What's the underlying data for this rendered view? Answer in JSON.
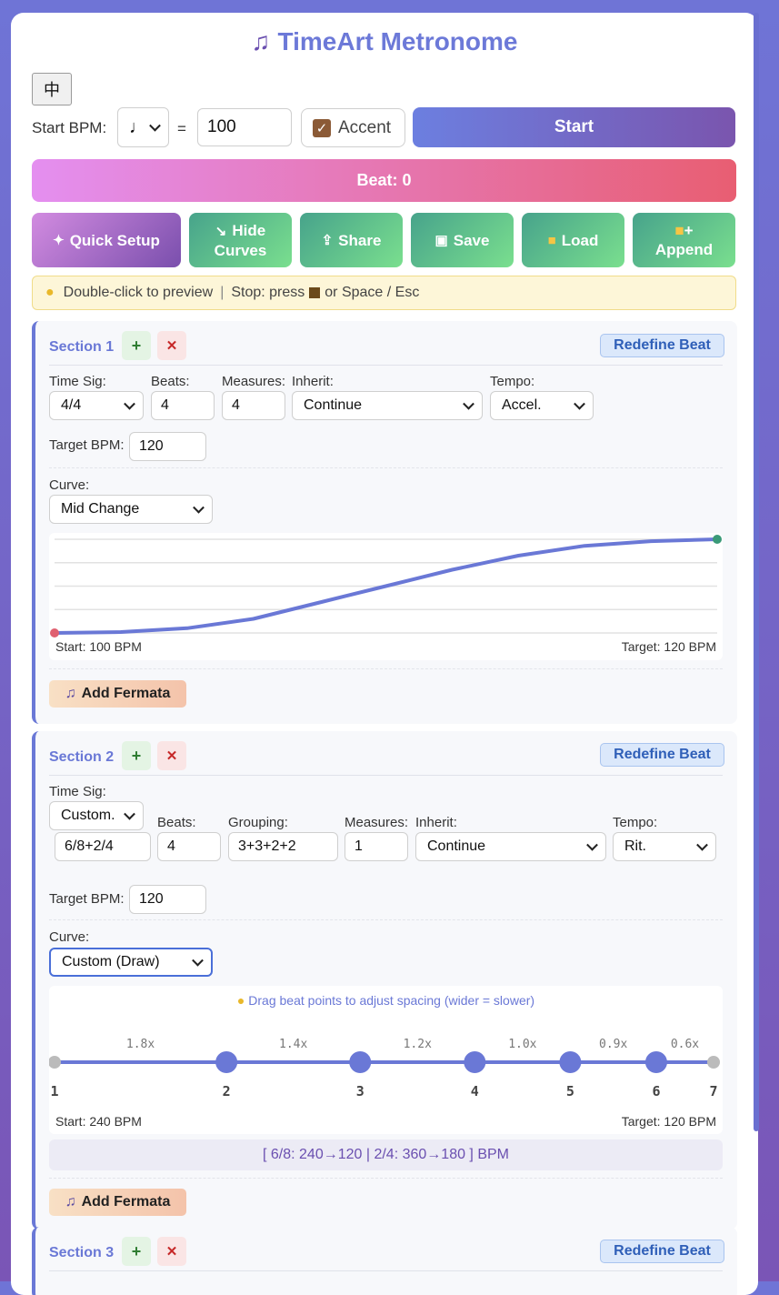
{
  "app": {
    "title": "TimeArt Metronome",
    "title_icon": "music-note-icon",
    "lang_button": "中"
  },
  "controls": {
    "start_bpm_label": "Start BPM:",
    "note_value": "♩",
    "equals": "=",
    "bpm_value": "100",
    "accent_label": "Accent",
    "accent_checked": true,
    "start_label": "Start"
  },
  "beat_display": "Beat: 0",
  "toolbar": {
    "quick_setup": "Quick Setup",
    "hide_curves_1": "Hide",
    "hide_curves_2": "Curves",
    "share": "Share",
    "save": "Save",
    "load": "Load",
    "append_1": "+",
    "append_2": "Append"
  },
  "hint": {
    "part1": "Double-click to preview",
    "sep": "|",
    "part2": "Stop: press",
    "part3": "or Space / Esc"
  },
  "sections": [
    {
      "title": "Section 1",
      "add": "+",
      "remove": "✕",
      "redefine": "Redefine Beat",
      "time_sig_label": "Time Sig:",
      "time_sig": "4/4",
      "beats_label": "Beats:",
      "beats": "4",
      "measures_label": "Measures:",
      "measures": "4",
      "inherit_label": "Inherit:",
      "inherit": "Continue",
      "tempo_label": "Tempo:",
      "tempo": "Accel.",
      "target_label": "Target BPM:",
      "target": "120",
      "curve_label": "Curve:",
      "curve": "Mid Change",
      "chart_start": "Start: 100 BPM",
      "chart_target": "Target: 120 BPM",
      "fermata": "Add Fermata"
    },
    {
      "title": "Section 2",
      "add": "+",
      "remove": "✕",
      "redefine": "Redefine Beat",
      "time_sig_label": "Time Sig:",
      "time_sig": "Custom.",
      "custom_sig": "6/8+2/4",
      "beats_label": "Beats:",
      "beats": "4",
      "grouping_label": "Grouping:",
      "grouping": "3+3+2+2",
      "measures_label": "Measures:",
      "measures": "1",
      "inherit_label": "Inherit:",
      "inherit": "Continue",
      "tempo_label": "Tempo:",
      "tempo": "Rit.",
      "target_label": "Target BPM:",
      "target": "120",
      "curve_label": "Curve:",
      "curve": "Custom (Draw)",
      "drag_hint": "Drag beat points to adjust spacing (wider = slower)",
      "chart_start": "Start: 240 BPM",
      "chart_target": "Target: 120 BPM",
      "bpm_summary": "[ 6/8: 240→120 | 2/4: 360→180 ] BPM",
      "fermata": "Add Fermata"
    },
    {
      "title": "Section 3",
      "add": "+",
      "remove": "✕",
      "redefine": "Redefine Beat"
    }
  ],
  "chart_data": [
    {
      "type": "line",
      "title": "",
      "xlabel": "",
      "ylabel": "",
      "x": [
        0,
        0.1,
        0.2,
        0.3,
        0.4,
        0.5,
        0.6,
        0.7,
        0.8,
        0.9,
        1.0
      ],
      "series": [
        {
          "values": [
            100,
            100.2,
            101,
            103,
            106.5,
            110,
            113.5,
            116.5,
            118.6,
            119.6,
            120
          ]
        }
      ],
      "ylim": [
        100,
        120
      ],
      "grid": true,
      "start_label": "Start: 100 BPM",
      "target_label": "Target: 120 BPM"
    },
    {
      "type": "scatter",
      "title": "",
      "beats": [
        "1",
        "2",
        "3",
        "4",
        "5",
        "6",
        "7"
      ],
      "multipliers": [
        "1.8x",
        "1.4x",
        "1.2x",
        "1.0x",
        "0.9x",
        "0.6x"
      ],
      "multiplier_values": [
        1.8,
        1.4,
        1.2,
        1.0,
        0.9,
        0.6
      ],
      "start_label": "Start: 240 BPM",
      "target_label": "Target: 120 BPM"
    }
  ],
  "colors": {
    "accent": "#6a78d6",
    "start_button": "#7a55ae",
    "beat_bar": "#e85e72",
    "green_button": "#47a38b"
  }
}
